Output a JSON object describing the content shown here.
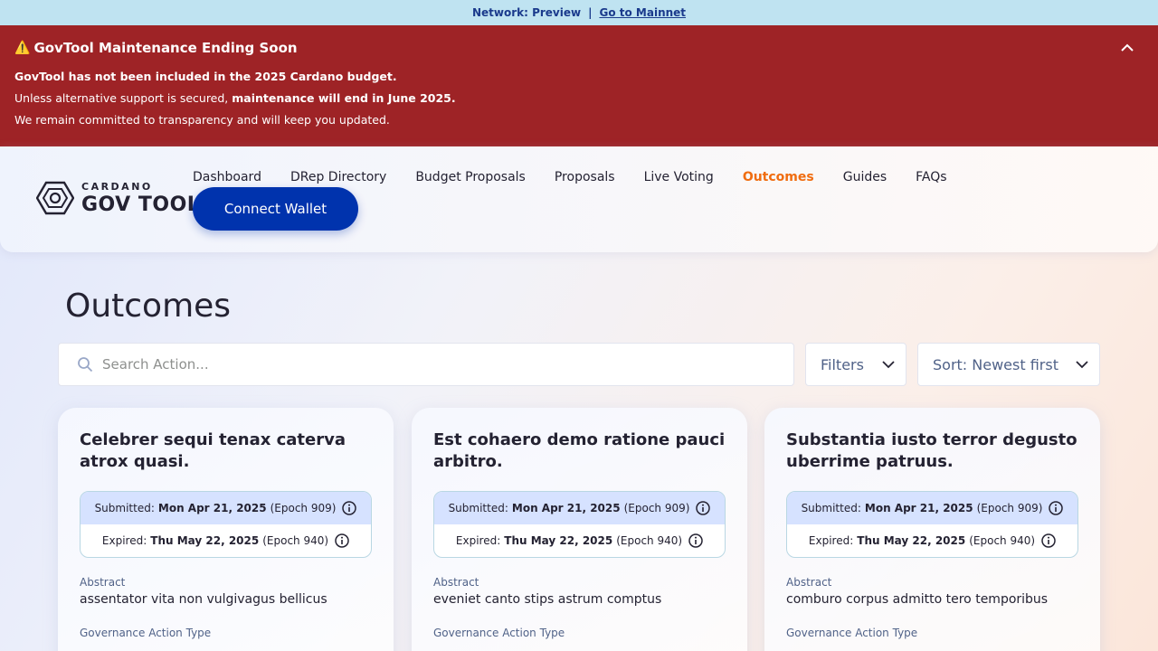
{
  "network_bar": {
    "label": "Network: Preview",
    "separator": "|",
    "link": "Go to Mainnet"
  },
  "banner": {
    "title": "GovTool Maintenance Ending Soon",
    "warning_icon": "⚠️",
    "line1": "GovTool has not been included in the 2025 Cardano budget.",
    "line2_prefix": "Unless alternative support is secured, ",
    "line2_bold": "maintenance will end in June 2025.",
    "line3": "We remain committed to transparency and will keep you updated."
  },
  "header": {
    "logo_small": "CARDANO",
    "logo_big": "GOV TOOL",
    "nav": [
      {
        "label": "Dashboard"
      },
      {
        "label": "DRep Directory"
      },
      {
        "label": "Budget Proposals"
      },
      {
        "label": "Proposals"
      },
      {
        "label": "Live Voting"
      },
      {
        "label": "Outcomes"
      },
      {
        "label": "Guides"
      },
      {
        "label": "FAQs"
      }
    ],
    "active_nav": "Outcomes",
    "connect_label": "Connect Wallet"
  },
  "page": {
    "title": "Outcomes",
    "search_placeholder": "Search Action...",
    "filters_label": "Filters",
    "sort_label": "Sort: Newest first"
  },
  "cards": [
    {
      "title": "Celebrer sequi tenax caterva atrox quasi.",
      "submitted_label": "Submitted:",
      "submitted_date": "Mon Apr 21, 2025",
      "submitted_epoch": "(Epoch 909)",
      "expired_label": "Expired:",
      "expired_date": "Thu May 22, 2025",
      "expired_epoch": "(Epoch 940)",
      "abstract_label": "Abstract",
      "abstract": "assentator vita non vulgivagus bellicus",
      "gat_label": "Governance Action Type"
    },
    {
      "title": "Est cohaero demo ratione pauci arbitro.",
      "submitted_label": "Submitted:",
      "submitted_date": "Mon Apr 21, 2025",
      "submitted_epoch": "(Epoch 909)",
      "expired_label": "Expired:",
      "expired_date": "Thu May 22, 2025",
      "expired_epoch": "(Epoch 940)",
      "abstract_label": "Abstract",
      "abstract": "eveniet canto stips astrum comptus",
      "gat_label": "Governance Action Type"
    },
    {
      "title": "Substantia iusto terror degusto uberrime patruus.",
      "submitted_label": "Submitted:",
      "submitted_date": "Mon Apr 21, 2025",
      "submitted_epoch": "(Epoch 909)",
      "expired_label": "Expired:",
      "expired_date": "Thu May 22, 2025",
      "expired_epoch": "(Epoch 940)",
      "abstract_label": "Abstract",
      "abstract": "comburo corpus admitto tero temporibus",
      "gat_label": "Governance Action Type"
    }
  ],
  "colors": {
    "banner_bg": "#9e2326",
    "network_bar_bg": "#bfe3f1",
    "primary": "#0033ad",
    "active_nav": "#f06d10",
    "submitted_row_bg": "#d6e2ff"
  },
  "icons": {
    "logo": "gov-tool-hex-logo-icon",
    "collapse": "chevron-up-icon",
    "search": "search-icon",
    "dropdown": "chevron-down-icon",
    "info": "info-icon",
    "warning": "warning-icon"
  }
}
